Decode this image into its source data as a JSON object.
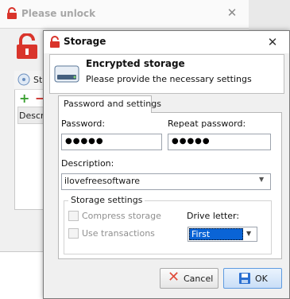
{
  "background_window": {
    "title": "Please unlock",
    "panel_label": "St",
    "grid_header": "Descri"
  },
  "dialog": {
    "title": "Storage",
    "header_title": "Encrypted storage",
    "header_subtitle": "Please provide the necessary settings",
    "tab_label": "Password and settings",
    "password_label": "Password:",
    "password_value": "●●●●●",
    "repeat_label": "Repeat password:",
    "repeat_value": "●●●●●",
    "description_label": "Description:",
    "description_value": "ilovefreesoftware",
    "storage_group_label": "Storage settings",
    "compress_label": "Compress storage",
    "compress_checked": false,
    "transactions_label": "Use transactions",
    "transactions_checked": false,
    "drive_label": "Drive letter:",
    "drive_value": "First",
    "cancel_label": "Cancel",
    "ok_label": "OK"
  },
  "colors": {
    "selection": "#0a64d6",
    "lock_red": "#d9342b",
    "ok_border": "#5e9be0"
  }
}
